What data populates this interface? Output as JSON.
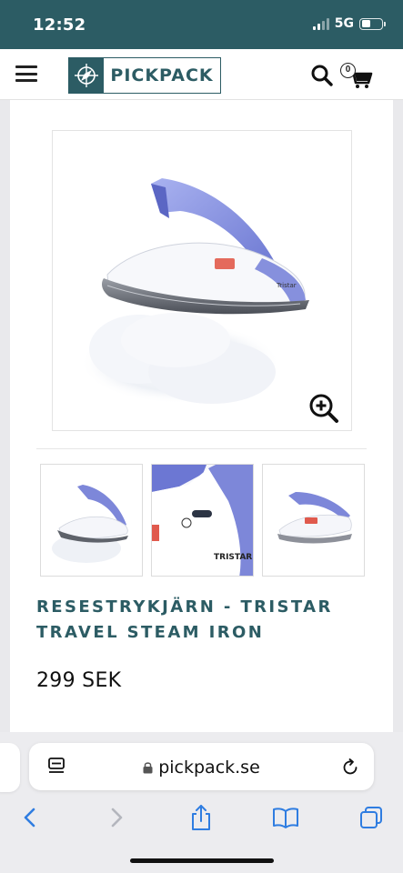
{
  "status_bar": {
    "time": "12:52",
    "network": "5G",
    "battery_level": 0.45
  },
  "header": {
    "menu_icon": "hamburger-icon",
    "logo_text": "PICKPACK",
    "logo_icon": "compass-icon",
    "search_icon": "search-icon",
    "cart_icon": "cart-icon",
    "cart_count": "0"
  },
  "product": {
    "title": "RESESTRYKJÄRN - TRISTAR TRAVEL STEAM IRON",
    "price": "299 SEK",
    "zoom_icon": "zoom-in-icon",
    "thumbnails": [
      {
        "alt": "thumbnail-1"
      },
      {
        "alt": "thumbnail-2",
        "brand": "TRISTAR"
      },
      {
        "alt": "thumbnail-3"
      }
    ]
  },
  "browser": {
    "url": "pickpack.se",
    "toolbar": [
      "back-icon",
      "forward-icon",
      "share-icon",
      "bookmarks-icon",
      "tabs-icon"
    ]
  },
  "colors": {
    "brand": "#2c5c64",
    "iron_purple": "#7d87d9",
    "ios_blue": "#2f7de1"
  }
}
